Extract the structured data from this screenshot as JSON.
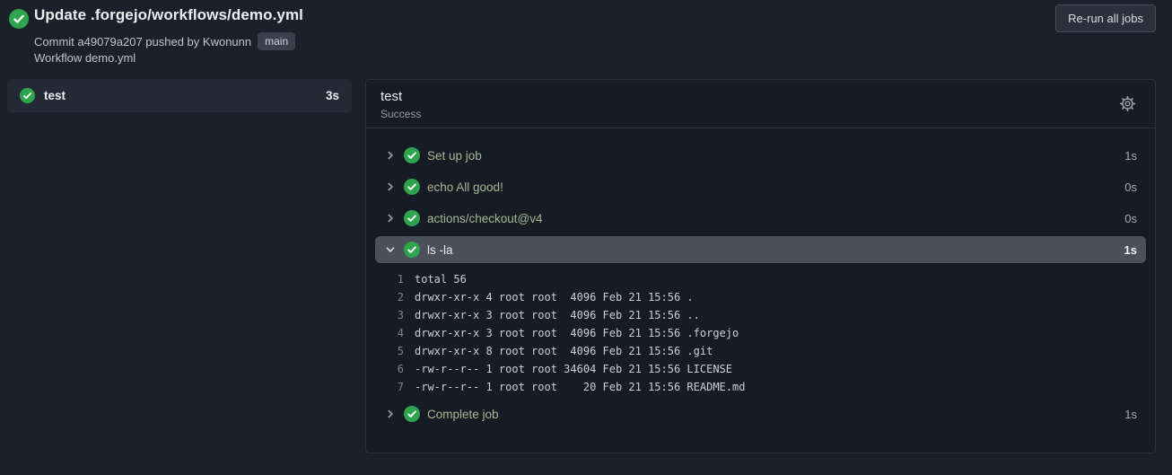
{
  "page": {
    "title": "Update .forgejo/workflows/demo.yml",
    "commit_text": "Commit a49079a207 pushed by Kwonunn",
    "branch_badge": "main",
    "workflow_text": "Workflow demo.yml",
    "rerun_button_label": "Re-run all jobs"
  },
  "sidebar": {
    "jobs": [
      {
        "name": "test",
        "duration": "3s",
        "status": "success"
      }
    ]
  },
  "job_panel": {
    "title": "test",
    "status": "Success",
    "settings_icon": "gear-icon",
    "steps": [
      {
        "label": "Set up job",
        "duration": "1s",
        "status": "success",
        "expanded": false
      },
      {
        "label": "echo All good!",
        "duration": "0s",
        "status": "success",
        "expanded": false
      },
      {
        "label": "actions/checkout@v4",
        "duration": "0s",
        "status": "success",
        "expanded": false
      },
      {
        "label": "ls -la",
        "duration": "1s",
        "status": "success",
        "expanded": true,
        "log": [
          {
            "num": "1",
            "text": "total 56"
          },
          {
            "num": "2",
            "text": "drwxr-xr-x 4 root root  4096 Feb 21 15:56 ."
          },
          {
            "num": "3",
            "text": "drwxr-xr-x 3 root root  4096 Feb 21 15:56 .."
          },
          {
            "num": "4",
            "text": "drwxr-xr-x 3 root root  4096 Feb 21 15:56 .forgejo"
          },
          {
            "num": "5",
            "text": "drwxr-xr-x 8 root root  4096 Feb 21 15:56 .git"
          },
          {
            "num": "6",
            "text": "-rw-r--r-- 1 root root 34604 Feb 21 15:56 LICENSE"
          },
          {
            "num": "7",
            "text": "-rw-r--r-- 1 root root    20 Feb 21 15:56 README.md"
          }
        ]
      },
      {
        "label": "Complete job",
        "duration": "1s",
        "status": "success",
        "expanded": false
      }
    ]
  },
  "colors": {
    "success_green": "#2ea44f",
    "page_background": "#1b202a",
    "panel_background": "#171b23",
    "expanded_row_background": "#4a515b",
    "step_label_green": "#a4b898"
  }
}
